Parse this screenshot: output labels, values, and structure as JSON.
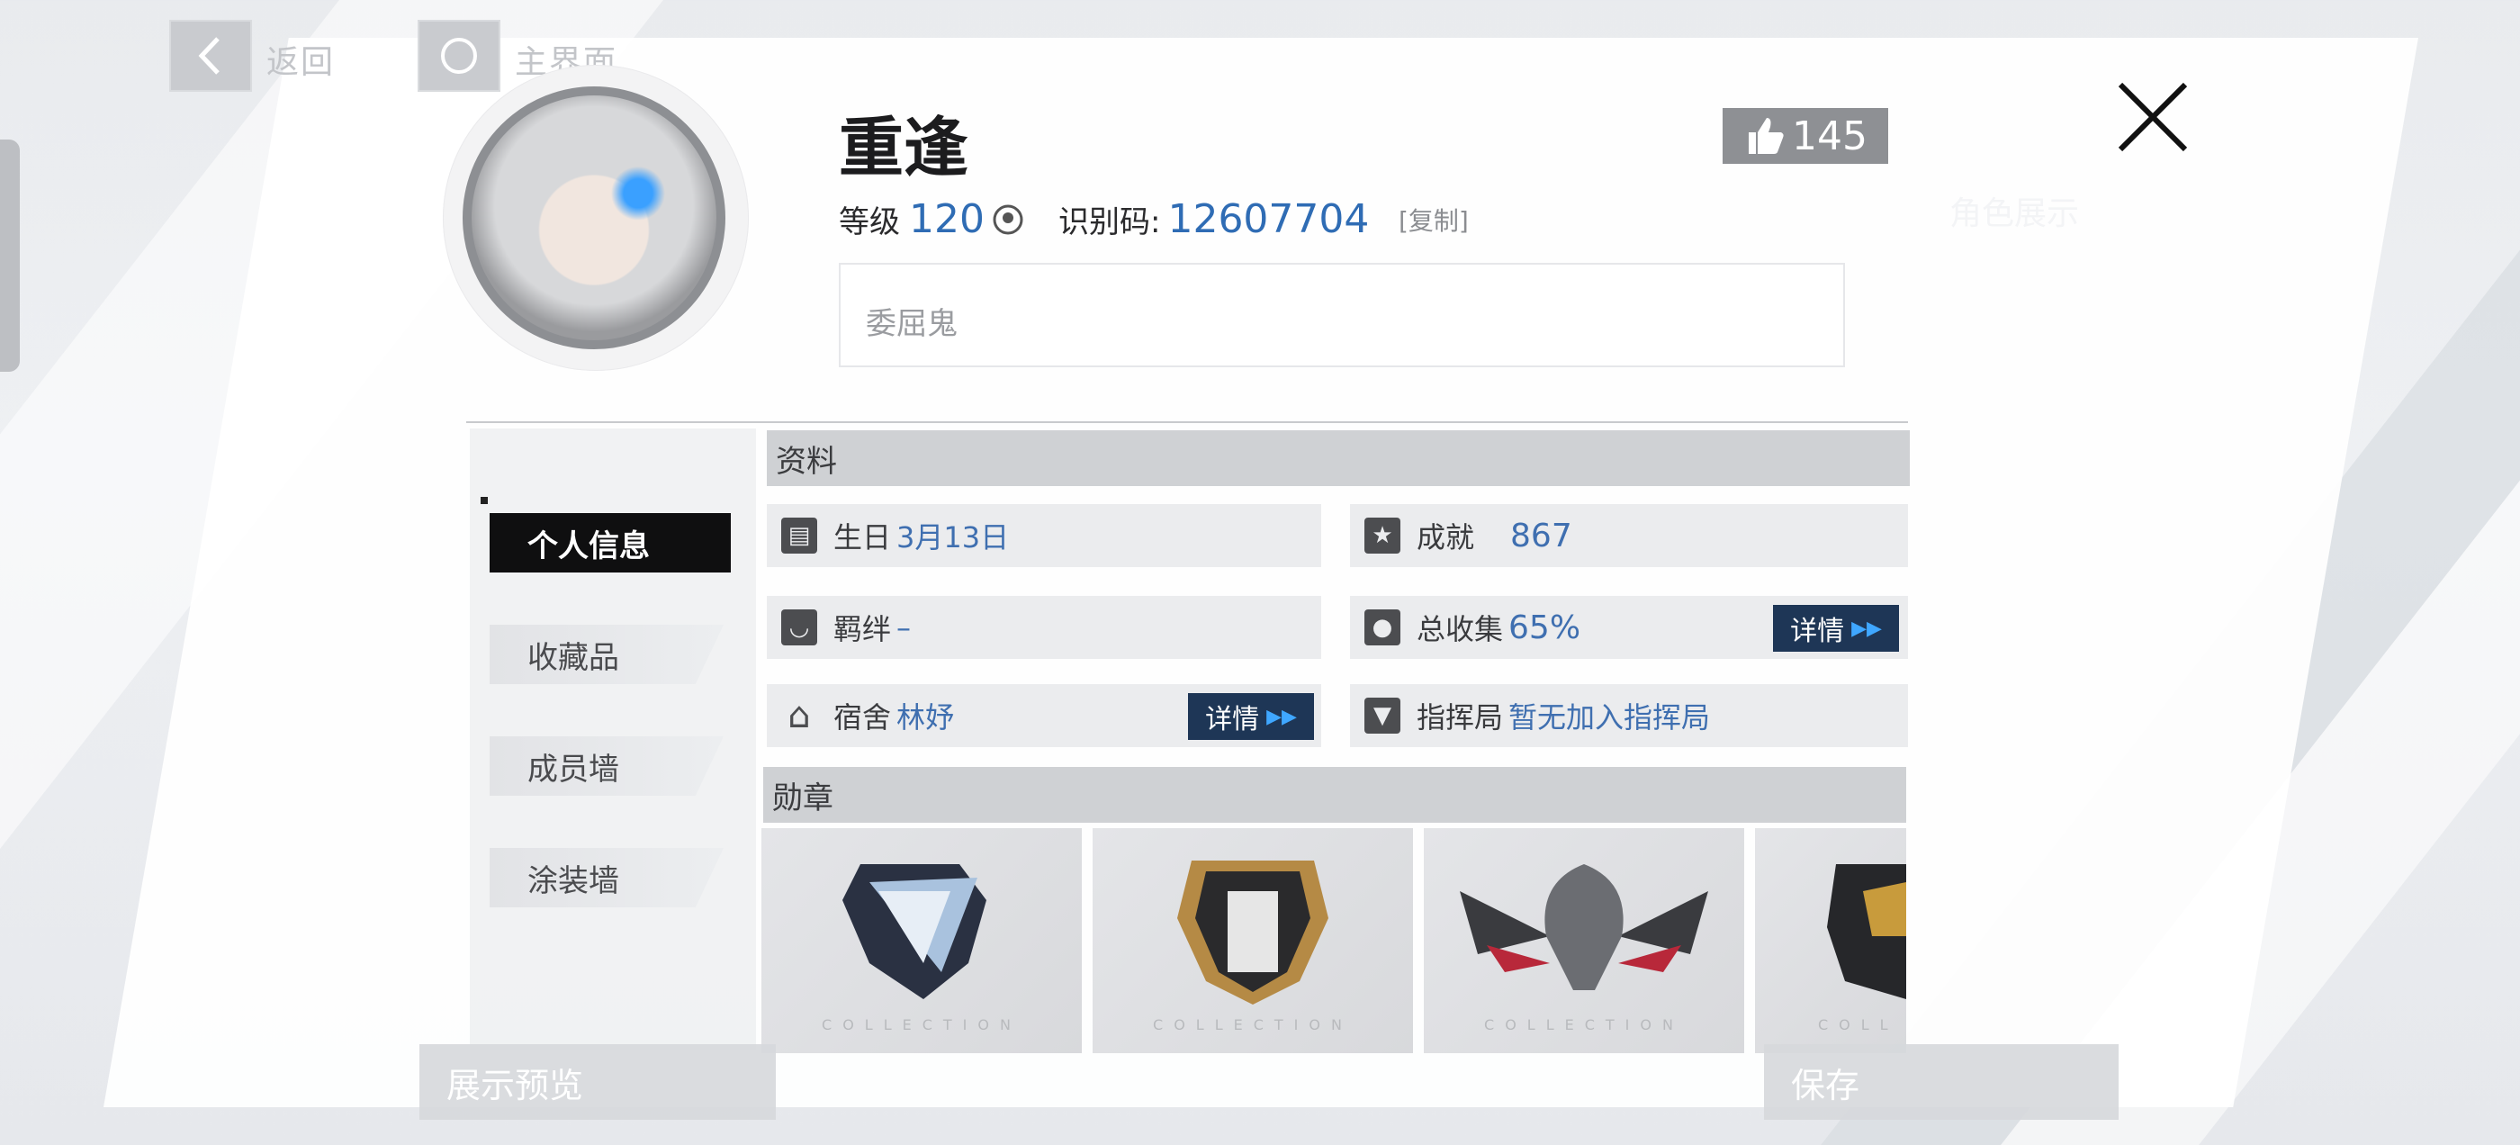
{
  "nav": {
    "back_label": "返回",
    "home_label": "主界面"
  },
  "profile": {
    "name": "重逢",
    "level_label": "等级",
    "level_value": "120",
    "id_label": "识别码:",
    "id_value": "12607704",
    "copy_label": "[复制]",
    "likes": "145",
    "signature": "委屈鬼"
  },
  "ghost_label": "角色展示",
  "menu": {
    "items": [
      {
        "label": "个人信息",
        "active": true
      },
      {
        "label": "收藏品"
      },
      {
        "label": "成员墙"
      },
      {
        "label": "涂装墙"
      }
    ]
  },
  "info": {
    "section_title": "资料",
    "birthday_label": "生日",
    "birthday_value": "3月13日",
    "achievement_label": "成就",
    "achievement_value": "867",
    "bond_label": "羁绊",
    "bond_value": "–",
    "collection_label": "总收集",
    "collection_value": "65%",
    "dorm_label": "宿舍",
    "dorm_value": "林妤",
    "command_label": "指挥局",
    "command_value": "暂无加入指挥局",
    "detail_label": "详情"
  },
  "medals": {
    "section_title": "勋章",
    "items": [
      {
        "name": "Grey Raven medal",
        "collection_text": "COLLECTION"
      },
      {
        "name": "Pioneer medal",
        "collection_text": "COLLECTION"
      },
      {
        "name": "Winged skull medal",
        "collection_text": "COLLECTION"
      },
      {
        "name": "Gold medal",
        "collection_text": "COLL"
      }
    ]
  },
  "bottom": {
    "preview_label": "展示预览",
    "save_label": "保存"
  }
}
